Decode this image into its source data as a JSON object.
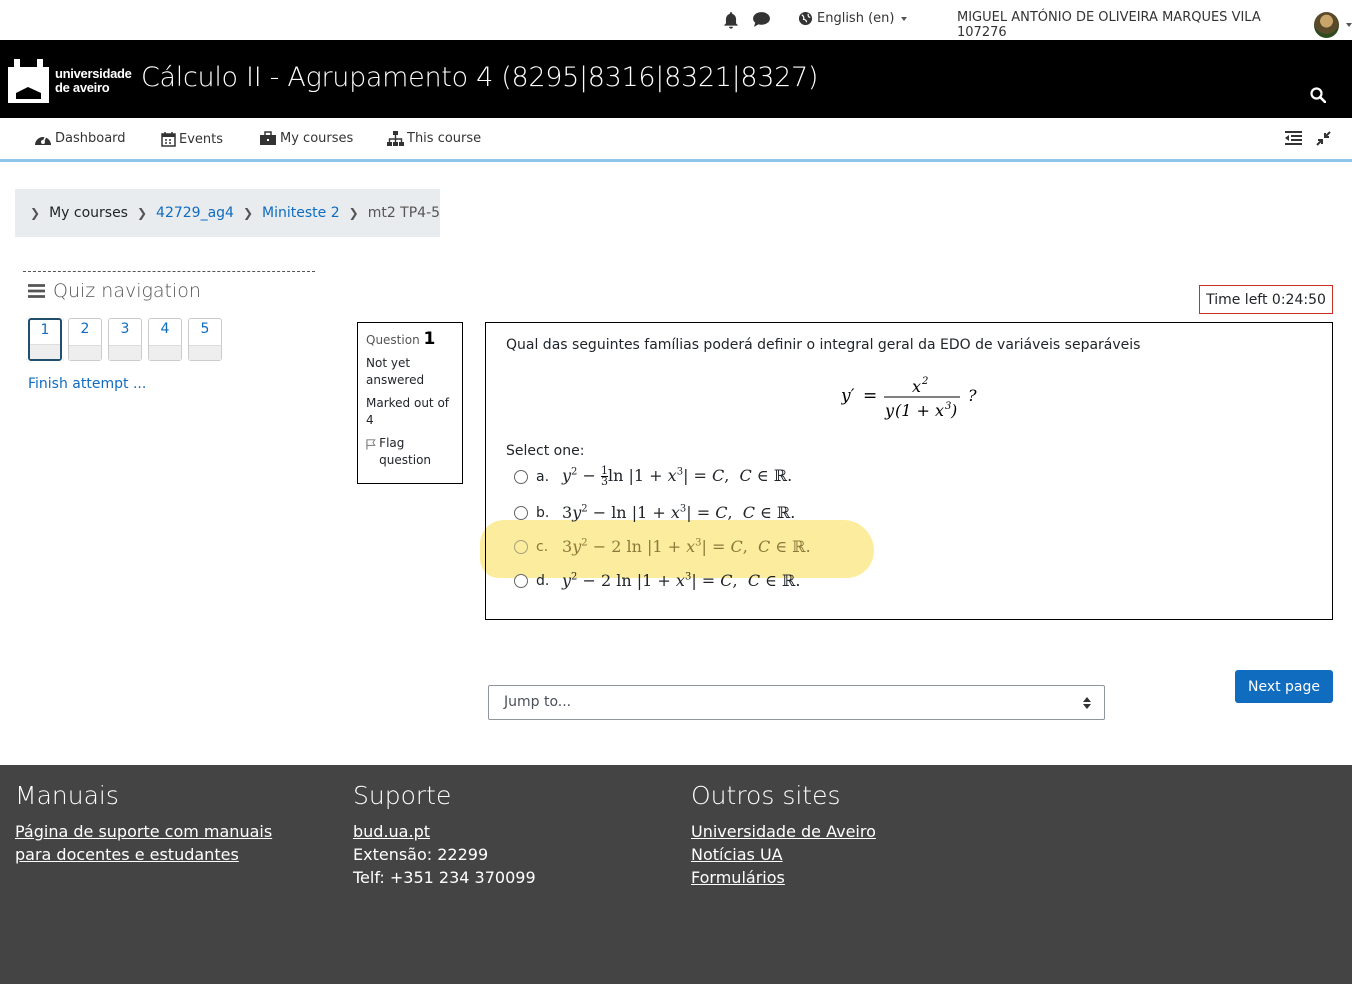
{
  "topbar": {
    "language": "English (en)",
    "user_name": "MIGUEL ANTÓNIO DE OLIVEIRA MARQUES VILA 107276"
  },
  "header": {
    "logo_line1": "universidade",
    "logo_line2": "de aveiro",
    "course_title": "Cálculo II - Agrupamento 4 (8295|8316|8321|8327)"
  },
  "nav": {
    "dashboard": "Dashboard",
    "events": "Events",
    "my_courses": "My courses",
    "this_course": "This course"
  },
  "breadcrumb": {
    "my_courses": "My courses",
    "course": "42729_ag4",
    "section": "Miniteste 2",
    "current": "mt2 TP4-5"
  },
  "quiz_nav": {
    "title": "Quiz navigation",
    "questions": [
      "1",
      "2",
      "3",
      "4",
      "5"
    ],
    "current_question": 1,
    "finish_link": "Finish attempt ..."
  },
  "timer": "Time left 0:24:50",
  "question_info": {
    "label": "Question",
    "number": "1",
    "state": "Not yet answered",
    "marks": "Marked out of 4",
    "flag": "Flag question"
  },
  "question": {
    "text": "Qual das seguintes famílias poderá definir o integral geral da EDO de variáveis separáveis",
    "select_one": "Select one:",
    "options": [
      {
        "letter": "a."
      },
      {
        "letter": "b."
      },
      {
        "letter": "c."
      },
      {
        "letter": "d."
      }
    ]
  },
  "controls": {
    "jump_to": "Jump to...",
    "next_page": "Next page"
  },
  "footer": {
    "col1_title": "Manuais",
    "col1_link1": "Página de suporte com manuais",
    "col1_link2": "para docentes e estudantes",
    "col2_title": "Suporte",
    "col2_link": "bud.ua.pt",
    "col2_ext": "Extensão: 22299",
    "col2_tel": "Telf: +351 234 370099",
    "col3_title": "Outros sites",
    "col3_link1": "Universidade de Aveiro",
    "col3_link2": "Notícias UA",
    "col3_link3": "Formulários"
  },
  "icons": [
    "bell-icon",
    "chat-icon",
    "globe-icon",
    "search-icon",
    "dashboard-icon",
    "calendar-icon",
    "briefcase-icon",
    "sitemap-icon",
    "home-icon",
    "hamburger-icon",
    "flag-icon"
  ],
  "colors": {
    "header_bg": "#000000",
    "link": "#0f6cbf",
    "footer_bg": "#444444",
    "timer_border": "#ca3120",
    "highlight": "#fbe98c"
  }
}
